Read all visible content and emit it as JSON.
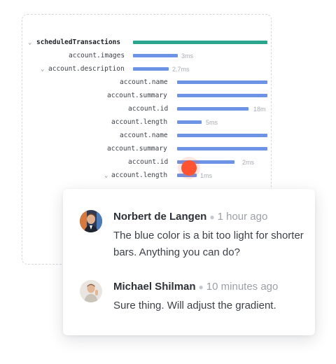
{
  "trace": {
    "rows": [
      {
        "label": "scheduledTransactions",
        "duration": "",
        "root": true,
        "expanded": true
      },
      {
        "label": "account.images",
        "duration": "3ms"
      },
      {
        "label": "account.description",
        "duration": "2.7ms",
        "expanded": true
      },
      {
        "label": "account.name",
        "duration": ""
      },
      {
        "label": "account.summary",
        "duration": ""
      },
      {
        "label": "account.id",
        "duration": "18m"
      },
      {
        "label": "account.length",
        "duration": "5ms"
      },
      {
        "label": "account.name",
        "duration": ""
      },
      {
        "label": "account.summary",
        "duration": ""
      },
      {
        "label": "account.id",
        "duration": "2ms"
      },
      {
        "label": "account.length",
        "duration": "1ms",
        "expanded": true
      }
    ]
  },
  "comments": [
    {
      "author": "Norbert de Langen",
      "time": "1 hour ago",
      "text": "The blue color is a bit too light for shorter bars. Anything you can do?"
    },
    {
      "author": "Michael Shilman",
      "time": "10 minutes ago",
      "text": "Sure thing. Will adjust the gradient."
    }
  ],
  "colors": {
    "root_bar": "#2ba68e",
    "child_bar": "#6d93e6",
    "cursor": "#ff5230"
  }
}
